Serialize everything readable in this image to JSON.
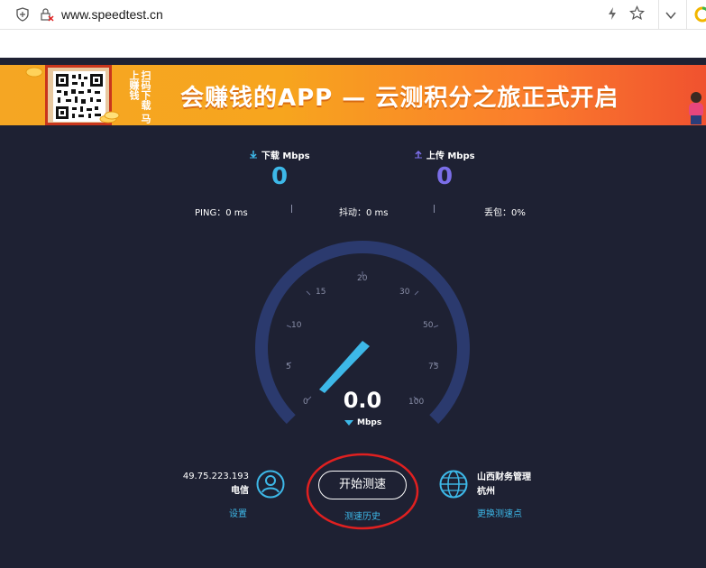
{
  "browser": {
    "url": "www.speedtest.cn",
    "icons": [
      "shield-icon",
      "insecure-lock-icon",
      "bolt-icon",
      "star-icon",
      "chevron-down-icon",
      "extension-icon"
    ]
  },
  "banner": {
    "scan_text": "扫码下载 马上赚钱",
    "title": "会赚钱的APP — 云测积分之旅正式开启"
  },
  "metrics": {
    "download": {
      "label": "下载",
      "unit": "Mbps",
      "value": "0"
    },
    "upload": {
      "label": "上传",
      "unit": "Mbps",
      "value": "0"
    },
    "ping": "PING：0 ms",
    "jitter": "抖动：0 ms",
    "loss": "丢包：0%"
  },
  "gauge": {
    "ticks": [
      "0",
      "5",
      "10",
      "15",
      "20",
      "30",
      "50",
      "75",
      "100"
    ],
    "speed": "0.0",
    "unit": "Mbps",
    "max": 100,
    "current": 0
  },
  "client": {
    "ip": "49.75.223.193",
    "isp": "电信",
    "settings": "设置"
  },
  "actions": {
    "start": "开始测速",
    "history": "测速历史"
  },
  "server": {
    "name": "山西财务管理",
    "city": "杭州",
    "change": "更换测速点"
  },
  "colors": {
    "background": "#1e2133",
    "download": "#3db8e8",
    "upload": "#7b6ee8",
    "gauge_arc": "#2b3a6e",
    "highlight": "#e02020"
  }
}
